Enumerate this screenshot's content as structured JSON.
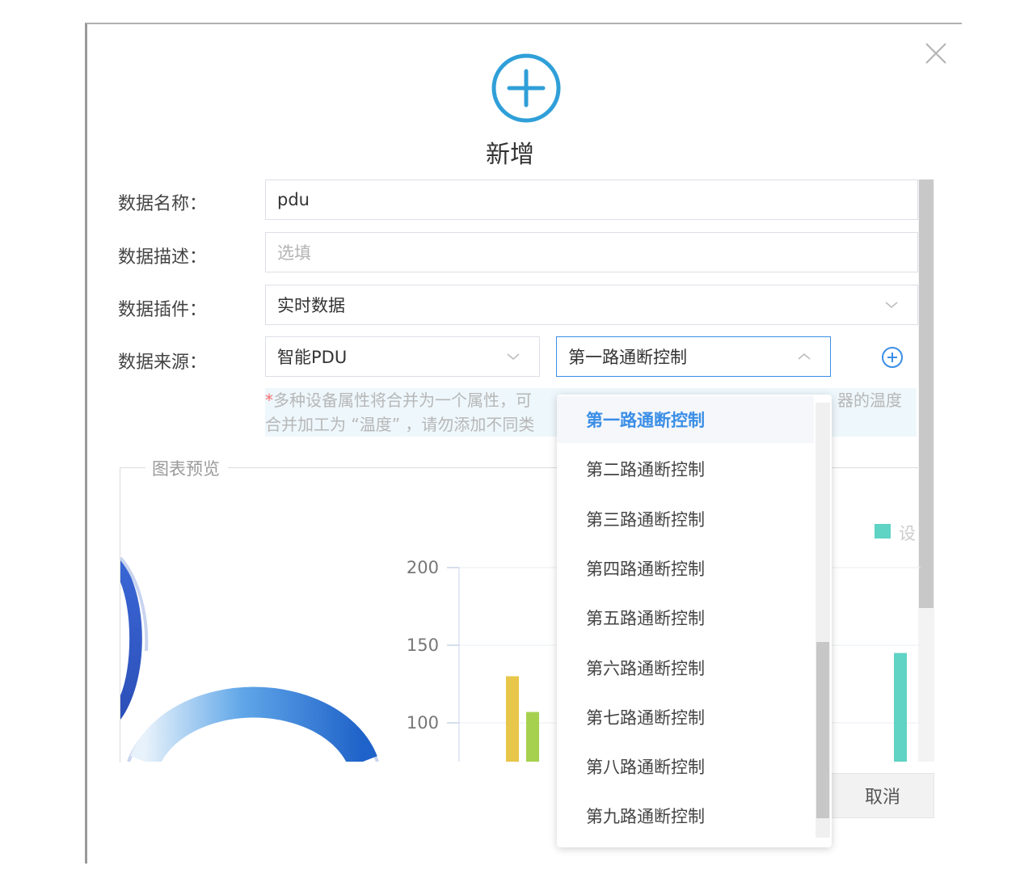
{
  "dialog": {
    "title": "新增",
    "header_icon": "plus-circle-icon",
    "close_icon": "close-icon",
    "accent_color": "#3a8ee6"
  },
  "form": {
    "name_label": "数据名称：",
    "name_value": "pdu",
    "desc_label": "数据描述：",
    "desc_placeholder": "选填",
    "plugin_label": "数据插件：",
    "plugin_value": "实时数据",
    "source_label": "数据来源：",
    "source_device": "智能PDU",
    "source_attribute": "第一路通断控制",
    "note_star": "*",
    "note_line1_left": "多种设备属性将合并为一个属性，可",
    "note_line1_right": "器的温度",
    "note_line2_left": "合并加工为 “温度” ，请勿添加不同类"
  },
  "dropdown": {
    "options": [
      "第一路通断控制",
      "第二路通断控制",
      "第三路通断控制",
      "第四路通断控制",
      "第五路通断控制",
      "第六路通断控制",
      "第七路通断控制",
      "第八路通断控制",
      "第九路通断控制"
    ],
    "selected_index": 0
  },
  "preview": {
    "label": "图表预览",
    "legend_text": "设"
  },
  "chart_data": {
    "type": "bar",
    "y_ticks": [
      "200",
      "150",
      "100"
    ],
    "ylim": [
      0,
      200
    ],
    "visible_range": [
      80,
      210
    ],
    "bars": [
      {
        "value": 130,
        "color": "#e8c64a"
      },
      {
        "value": 107,
        "color": "#a6d14f"
      },
      {
        "value": 145,
        "color": "#5fd3c4"
      }
    ]
  },
  "footer": {
    "cancel_label": "取消"
  }
}
